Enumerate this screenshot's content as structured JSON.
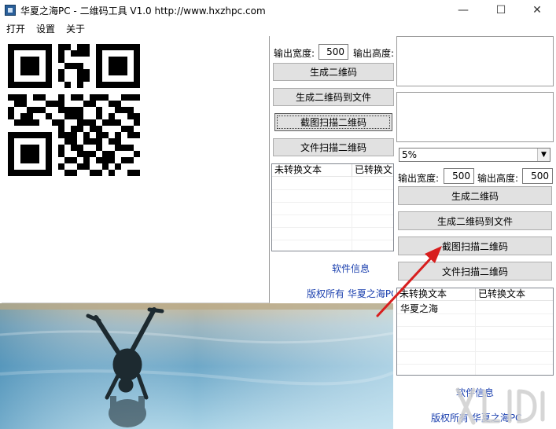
{
  "window": {
    "title": "华夏之海PC - 二维码工具 V1.0  http://www.hxzhpc.com",
    "minimize": "—",
    "maximize": "☐",
    "close": "✕"
  },
  "menu": [
    "打开",
    "设置",
    "关于"
  ],
  "middle": {
    "width_label": "输出宽度:",
    "width_value": "500",
    "height_label": "输出高度:",
    "generate_label": "生成二维码",
    "generate_file_label": "生成二维码到文件",
    "screenshot_scan_label": "截图扫描二维码",
    "file_scan_label": "文件扫描二维码",
    "list_headers": [
      "未转换文本",
      "已转换文"
    ],
    "software_info": "软件信息",
    "copyright": "版权所有  华夏之海PC"
  },
  "right": {
    "select_value": "5%",
    "width_label": "输出宽度:",
    "width_value": "500",
    "height_label": "输出高度:",
    "height_value": "500",
    "generate_label": "生成二维码",
    "generate_file_label": "生成二维码到文件",
    "screenshot_scan_label": "截图扫描二维码",
    "file_scan_label": "文件扫描二维码",
    "list_headers": [
      "未转换文本",
      "已转换文本"
    ],
    "list_rows": [
      [
        "华夏之海",
        ""
      ]
    ],
    "software_info": "软件信息",
    "copyright": "版权所有  华夏之海PC"
  },
  "annotation": {
    "arrow_color": "#d81e1e"
  },
  "colors": {
    "link": "#1a3fae",
    "button_face": "#e1e1e1",
    "button_border": "#adadad"
  }
}
